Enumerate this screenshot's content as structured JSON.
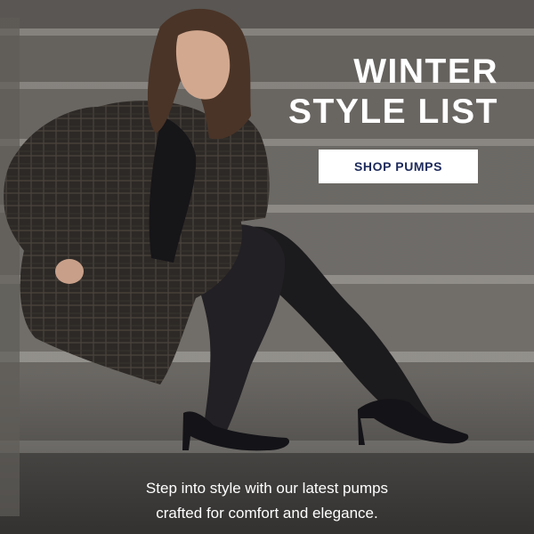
{
  "banner": {
    "headline_line1": "WINTER",
    "headline_line2": "STYLE LIST",
    "cta_label": "SHOP PUMPS",
    "body_line1": "Step into style with our latest pumps",
    "body_line2": "crafted for comfort and elegance."
  },
  "colors": {
    "text": "#ffffff",
    "cta_background": "#ffffff",
    "cta_text": "#1d2a5b"
  }
}
